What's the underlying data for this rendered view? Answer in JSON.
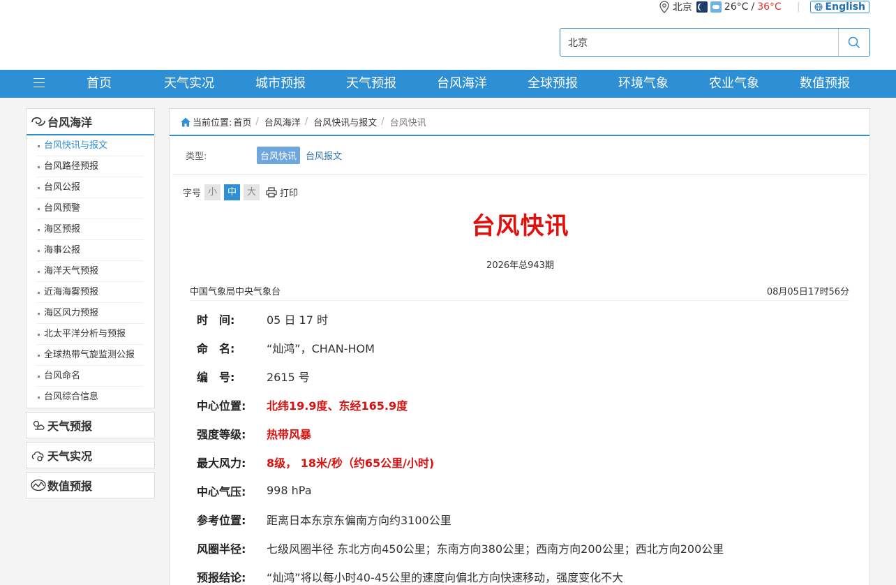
{
  "header": {
    "city": "北京",
    "temperature_low": "26°C",
    "temp_separator": "/",
    "temperature_high": "36°C",
    "divider": "|",
    "lang_label": "English",
    "search_value": "北京"
  },
  "nav": {
    "items": [
      "首页",
      "天气实况",
      "城市预报",
      "天气预报",
      "台风海洋",
      "全球预报",
      "环境气象",
      "农业气象",
      "数值预报"
    ]
  },
  "sidebar": {
    "title": "台风海洋",
    "items": [
      {
        "label": "台风快讯与报文",
        "active": true
      },
      {
        "label": "台风路径预报"
      },
      {
        "label": "台风公报"
      },
      {
        "label": "台风预警"
      },
      {
        "label": "海区预报"
      },
      {
        "label": "海事公报"
      },
      {
        "label": "海洋天气预报"
      },
      {
        "label": "近海海雾预报"
      },
      {
        "label": "海区风力预报"
      },
      {
        "label": "北太平洋分析与预报"
      },
      {
        "label": "全球热带气旋监测公报"
      },
      {
        "label": "台风命名"
      },
      {
        "label": "台风综合信息"
      }
    ],
    "groups": [
      "天气预报",
      "天气实况",
      "数值预报"
    ]
  },
  "breadcrumb": {
    "label": "当前位置:",
    "items": [
      "首页",
      "台风海洋",
      "台风快讯与报文"
    ],
    "current": "台风快讯"
  },
  "type_filter": {
    "label": "类型:",
    "options": [
      "台风快讯",
      "台风报文"
    ]
  },
  "font_size": {
    "label": "字号",
    "options": [
      "小",
      "中",
      "大"
    ],
    "selected": "中",
    "print_label": "打印"
  },
  "article": {
    "title": "台风快讯",
    "issue": "2026年总943期",
    "source": "中国气象局中央气象台",
    "published": "08月05日17时56分",
    "fields": [
      {
        "label": "时　间:",
        "value": "05 日 17 时",
        "highlight": false
      },
      {
        "label": "命　名:",
        "value": "“灿鸿”，CHAN-HOM",
        "highlight": false
      },
      {
        "label": "编　号:",
        "value": "2615 号",
        "highlight": false
      },
      {
        "label": "中心位置:",
        "value": "北纬19.9度、东经165.9度",
        "highlight": true
      },
      {
        "label": "强度等级:",
        "value": "热带风暴",
        "highlight": true
      },
      {
        "label": "最大风力:",
        "value": "8级， 18米/秒（约65公里/小时)",
        "highlight": true
      },
      {
        "label": "中心气压:",
        "value": "998 hPa",
        "highlight": false
      },
      {
        "label": "参考位置:",
        "value": "距离日本东京东偏南方向约3100公里",
        "highlight": false
      },
      {
        "label": "风圈半径:",
        "value": "七级风圈半径 东北方向450公里；东南方向380公里；西南方向200公里；西北方向200公里",
        "highlight": false
      },
      {
        "label": "预报结论:",
        "value": "“灿鸿”将以每小时40-45公里的速度向偏北方向快速移动，强度变化不大",
        "highlight": false
      }
    ]
  },
  "colors": {
    "primary": "#2e8fd5",
    "title_red": "#e0100d",
    "highlight_red": "#d9110f"
  }
}
